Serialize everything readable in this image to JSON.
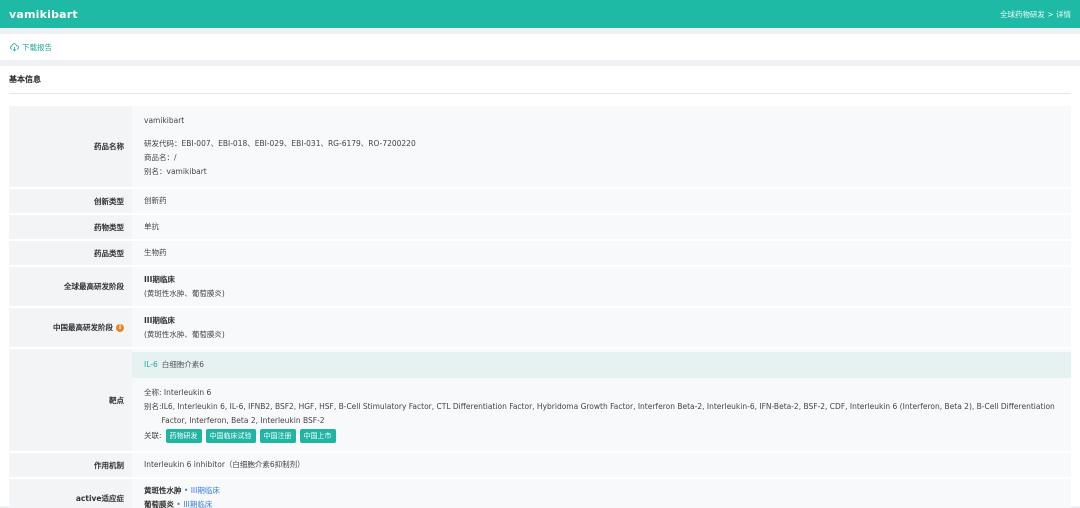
{
  "header": {
    "title": "vamikibart",
    "breadcrumb": "全球药物研发 > 详情"
  },
  "toolbar": {
    "download_label": "下载报告",
    "icon": "cloud-download-icon"
  },
  "section": {
    "title": "基本信息"
  },
  "colors": {
    "accent": "#1fbaa6",
    "tag": "#1fb5a2",
    "link": "#3b7dd8",
    "warn": "#e8862a"
  },
  "drug_name": {
    "label": "药品名称",
    "name": "vamikibart",
    "codes": "研发代码：EBI-007、EBI-018、EBI-029、EBI-031、RG-6179、RO-7200220",
    "trade": "商品名：/",
    "alias": "别名：vamikibart"
  },
  "rows": {
    "innovation": {
      "label": "创新类型",
      "value": "创新药"
    },
    "drug_type": {
      "label": "药物类型",
      "value": "单抗"
    },
    "product_type": {
      "label": "药品类型",
      "value": "生物药"
    },
    "global_phase": {
      "label": "全球最高研发阶段",
      "phase": "III期临床",
      "detail": "(黄斑性水肿、葡萄膜炎)"
    },
    "china_phase": {
      "label": "中国最高研发阶段",
      "phase": "III期临床",
      "detail": "(黄斑性水肿、葡萄膜炎)"
    }
  },
  "target": {
    "label": "靶点",
    "code": "IL-6",
    "cn_name": "白细胞介素6",
    "fullname": "全称: Interleukin 6",
    "alias_key": "别名: ",
    "alias_value": "IL6, Interleukin 6, IL-6, IFNB2, BSF2, HGF, HSF, B-Cell Stimulatory Factor, CTL Differentiation Factor, Hybridoma Growth Factor, Interferon Beta-2, Interleukin-6, IFN-Beta-2, BSF-2, CDF, Interleukin 6 (Interferon, Beta 2), B-Cell Differentiation Factor, Interferon, Beta 2, Interleukin BSF-2",
    "related_label": "关联:",
    "tags": [
      "药物研发",
      "中国临床试验",
      "中国注册",
      "中国上市"
    ]
  },
  "mechanism": {
    "label": "作用机制",
    "value": "Interleukin 6 inhibitor（白细胞介素6抑制剂）"
  },
  "indications": {
    "label": "active适应症",
    "items": [
      {
        "name": "黄斑性水肿",
        "sep": " • ",
        "phase": "III期临床"
      },
      {
        "name": "葡萄膜炎",
        "sep": " • ",
        "phase": "III期临床"
      }
    ]
  }
}
